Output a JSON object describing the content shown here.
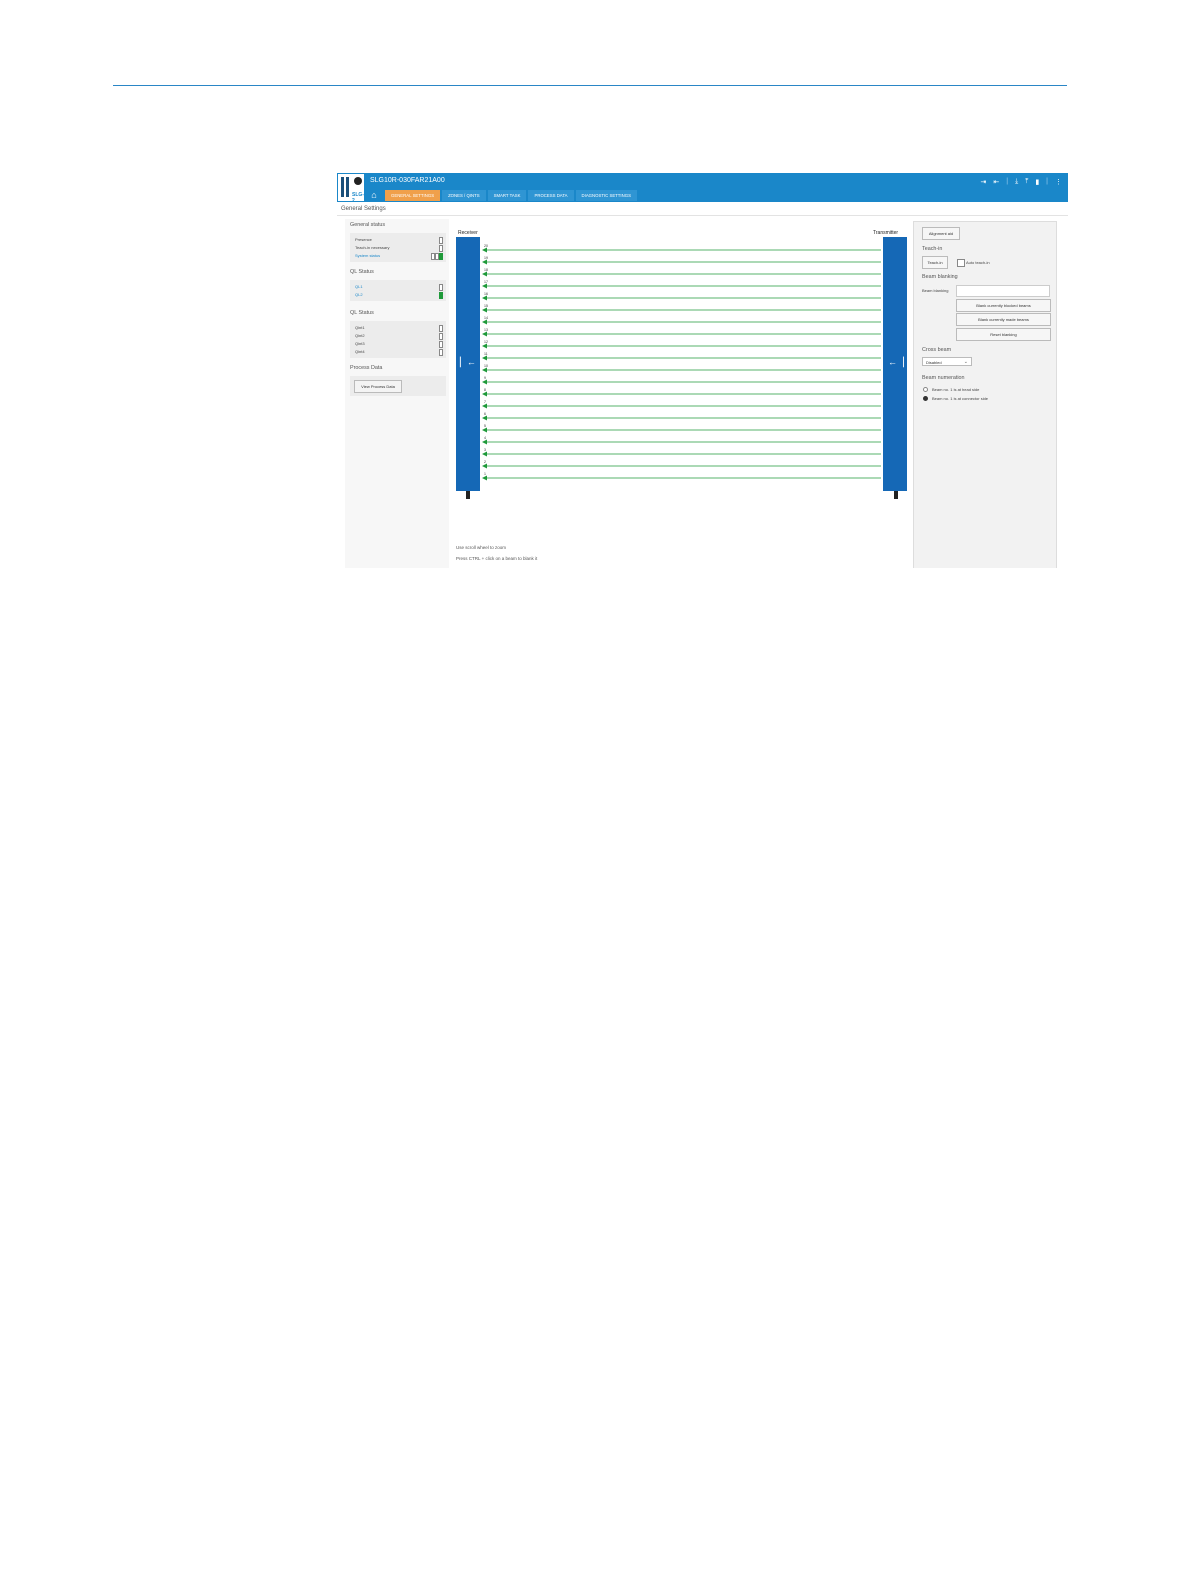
{
  "app": {
    "device_title": "SLG10R-030FAR21A00",
    "logo_label": "SLG-2"
  },
  "tabs": [
    {
      "label": "GENERAL SETTINGS",
      "active": true
    },
    {
      "label": "ZONES / QINTS",
      "active": false
    },
    {
      "label": "SMART TASK",
      "active": false
    },
    {
      "label": "PROCESS DATA",
      "active": false
    },
    {
      "label": "DIAGNOSTIC SETTINGS",
      "active": false
    }
  ],
  "section_title": "General Settings",
  "general_status": {
    "title": "General status",
    "rows": [
      "Presence",
      "Teach-in necessary",
      "System status"
    ]
  },
  "ql_status_1": {
    "title": "QL Status",
    "rows": [
      "QL1",
      "QL2"
    ]
  },
  "ql_status_2": {
    "title": "QL Status",
    "rows": [
      "Qint1",
      "Qint2",
      "Qint3",
      "Qint4"
    ]
  },
  "process_data": {
    "title": "Process Data",
    "button": "View Process Data"
  },
  "canvas": {
    "receiver": "Receiver",
    "transmitter": "Transmitter",
    "hint1": "Use scroll wheel to zoom",
    "hint2": "Press CTRL + click on a beam to blank it",
    "beam_count": 20,
    "beam_color": "#1f9a3a"
  },
  "right_panel": {
    "alignment_aid": "Alignment aid",
    "teach_in_title": "Teach-in",
    "teach_in_button": "Teach-in",
    "auto_teach_in": "Auto teach-in",
    "beam_blanking_title": "Beam blanking",
    "beam_blanking_label": "Beam blanking",
    "btn_blank_blocked": "Blank currently blocked beams",
    "btn_blank_made": "Blank currently made beams",
    "btn_reset": "Reset blanking",
    "cross_beam_title": "Cross beam",
    "cross_beam_value": "Disabled",
    "beam_numeration_title": "Beam numeration",
    "numeration_opt1": "Beam no. 1 is at head side",
    "numeration_opt2": "Beam no. 1 is at connector side"
  },
  "colors": {
    "header": "#1a87c9",
    "active_tab": "#f0a04b",
    "bar": "#1568b6",
    "ok": "#1f9a3a"
  }
}
